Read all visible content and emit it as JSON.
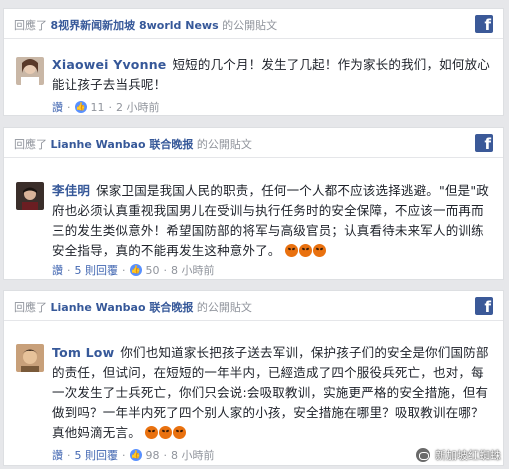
{
  "colors": {
    "background": "#e6e7ea",
    "page_link": "#365899",
    "facebook_blue": "#3b5998",
    "meta_gray": "#90949c",
    "angry_orange": "#e9710f"
  },
  "cards": [
    {
      "header": {
        "prefix": "回應了",
        "page_name": "8视界新闻新加坡 8world News",
        "suffix": "的公開貼文"
      },
      "comment": {
        "author": "Xiaowei Yvonne",
        "text": "短短的几个月！发生了几起！作为家长的我们，如何放心能让孩子去当兵呢！"
      },
      "meta": {
        "like": "讚",
        "like_count": "11",
        "time": "2 小時前"
      }
    },
    {
      "header": {
        "prefix": "回應了",
        "page_name": "Lianhe Wanbao 联合晚报",
        "suffix": "的公開貼文"
      },
      "comment": {
        "author": "李佳明",
        "text": "保家卫国是我国人民的职责，任何一个人都不应该选择逃避。\"但是\"政府也必须认真重视我国男儿在受训与执行任务时的安全保障，不应该一而再而三的发生类似意外！希望国防部的将军与高级官员；认真看待未来军人的训练安全指导，真的不能再发生这种意外了。"
      },
      "meta": {
        "like": "讚",
        "replies": "5 則回覆",
        "like_count": "50",
        "time": "8 小時前"
      }
    },
    {
      "header": {
        "prefix": "回應了",
        "page_name": "Lianhe Wanbao 联合晚报",
        "suffix": "的公開貼文"
      },
      "comment": {
        "author": "Tom Low",
        "text": "你们也知道家长把孩子送去军训，保护孩子们的安全是你们国防部的责任，但试问，在短短的一年半内，已經造成了四个服役兵死亡，也对，每一次发生了士兵死亡，你们只会说:会吸取教训，实施更严格的安全措施，但有做到吗？一年半内死了四个别人家的小孩，安全措施在哪里？吸取教训在哪？真他妈滴无言。"
      },
      "meta": {
        "like": "讚",
        "replies": "5 則回覆",
        "like_count": "98",
        "time": "8 小時前"
      }
    }
  ],
  "icons": {
    "facebook": "facebook-icon",
    "like": "like-icon",
    "angry": "angry-emoji-icon"
  },
  "watermark": {
    "text": "新加坡红蜘蛛"
  }
}
